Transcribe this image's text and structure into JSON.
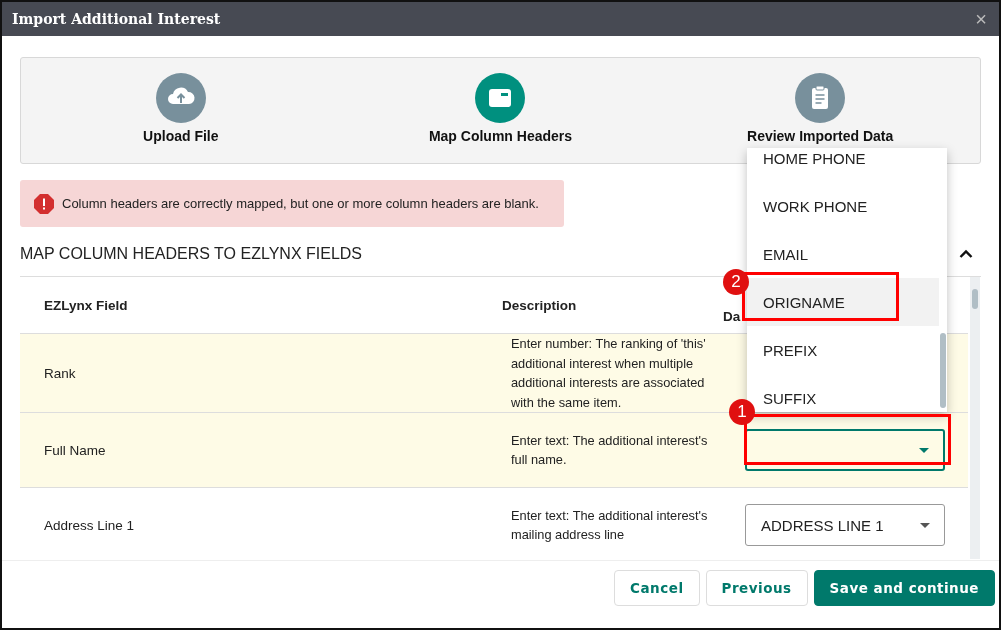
{
  "window": {
    "title": "Import Additional Interest",
    "close": "×"
  },
  "steps": [
    {
      "kind": "upload",
      "label": "Upload File",
      "active": false
    },
    {
      "kind": "map",
      "label": "Map Column Headers",
      "active": true
    },
    {
      "kind": "review",
      "label": "Review Imported Data",
      "active": false
    }
  ],
  "alert": {
    "text": "Column headers are correctly mapped, but one or more column headers are blank."
  },
  "section": {
    "title": "MAP COLUMN HEADERS TO EZLYNX FIELDS",
    "expanded": true
  },
  "table": {
    "columns": [
      "EZLynx Field",
      "Description",
      "Da"
    ],
    "rows": [
      {
        "field": "Rank",
        "description": "Enter number: The ranking of 'this' additional interest when multiple additional interests are associated with the same item.",
        "highlighted": true,
        "select_shown": false
      },
      {
        "field": "Full Name",
        "description": "Enter text: The additional interest's full name.",
        "highlighted": true,
        "select_shown": true,
        "focused": true
      },
      {
        "field": "Address Line 1",
        "description": "Enter text: The additional interest's mailing address line",
        "highlighted": false,
        "select_shown": true,
        "focused": false,
        "value": "ADDRESS LINE 1"
      }
    ]
  },
  "dropdown": {
    "options": [
      {
        "label": "HOME PHONE",
        "selected": false
      },
      {
        "label": "WORK PHONE",
        "selected": false
      },
      {
        "label": "EMAIL",
        "selected": false
      },
      {
        "label": "ORIGNAME",
        "selected": true
      },
      {
        "label": "PREFIX",
        "selected": false
      },
      {
        "label": "SUFFIX",
        "selected": false
      }
    ]
  },
  "annotations": [
    {
      "number": "1"
    },
    {
      "number": "2"
    }
  ],
  "buttons": [
    {
      "label": "Cancel",
      "kind": "outline"
    },
    {
      "label": "Previous",
      "kind": "outline"
    },
    {
      "label": "Save and continue",
      "kind": "primary"
    }
  ]
}
